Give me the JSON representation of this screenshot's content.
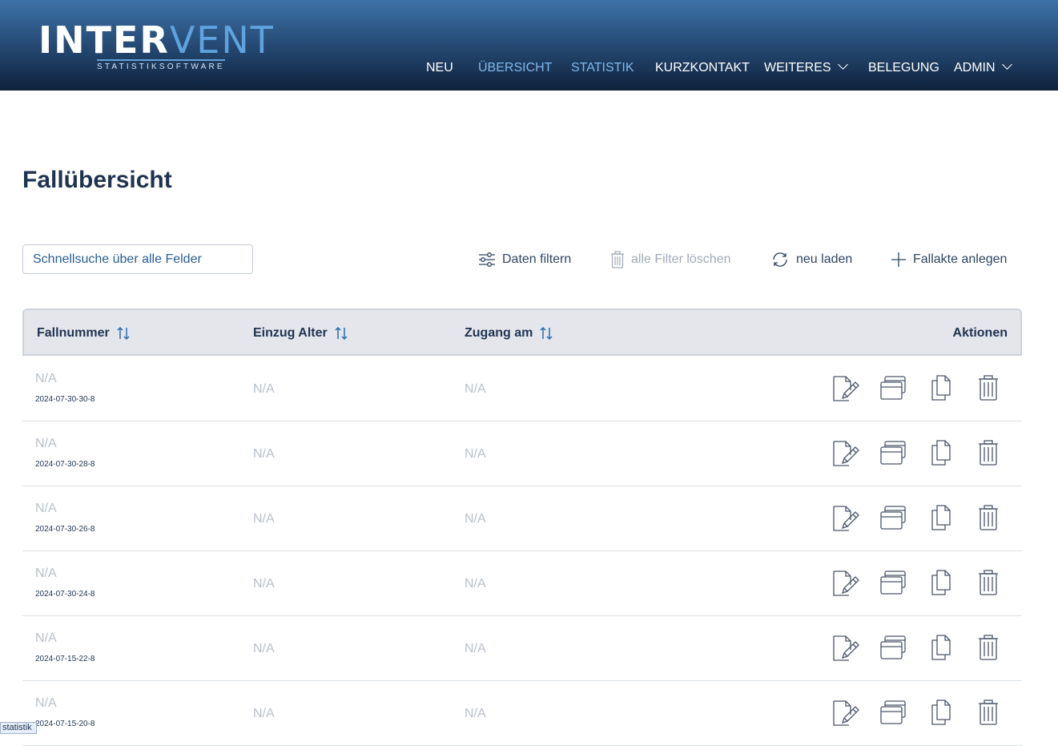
{
  "logo": {
    "word_part1": "INTER",
    "word_part2": "VENT",
    "tagline": "STATISTIKSOFTWARE"
  },
  "nav": {
    "items": [
      {
        "label": "NEU",
        "active": false
      },
      {
        "label": "ÜBERSICHT",
        "active": true
      },
      {
        "label": "STATISTIK",
        "active": true
      },
      {
        "label": "KURZKONTAKT",
        "active": false
      },
      {
        "label": "WEITERES",
        "active": false,
        "dropdown": true
      },
      {
        "label": "BELEGUNG",
        "active": false
      },
      {
        "label": "ADMIN",
        "active": false,
        "dropdown": true
      }
    ]
  },
  "page": {
    "title": "Fallübersicht"
  },
  "search": {
    "placeholder": "Schnellsuche über alle Felder"
  },
  "toolbar": {
    "filter_label": "Daten filtern",
    "clear_label": "alle Filter löschen",
    "reload_label": "neu laden",
    "create_label": "Fallakte anlegen"
  },
  "table": {
    "columns": {
      "case_number": "Fallnummer",
      "entry_age": "Einzug Alter",
      "access_date": "Zugang am",
      "actions": "Aktionen"
    },
    "rows": [
      {
        "case_number": "N/A",
        "id": "2024-07-30-30-8",
        "entry_age": "N/A",
        "access_date": "N/A"
      },
      {
        "case_number": "N/A",
        "id": "2024-07-30-28-8",
        "entry_age": "N/A",
        "access_date": "N/A"
      },
      {
        "case_number": "N/A",
        "id": "2024-07-30-26-8",
        "entry_age": "N/A",
        "access_date": "N/A"
      },
      {
        "case_number": "N/A",
        "id": "2024-07-30-24-8",
        "entry_age": "N/A",
        "access_date": "N/A"
      },
      {
        "case_number": "N/A",
        "id": "2024-07-15-22-8",
        "entry_age": "N/A",
        "access_date": "N/A"
      },
      {
        "case_number": "N/A",
        "id": "2024-07-15-20-8",
        "entry_age": "N/A",
        "access_date": "N/A"
      }
    ]
  },
  "tooltip": {
    "text": "statistik"
  },
  "icons": {
    "filter": "sliders-icon",
    "clear": "trash-icon",
    "reload": "refresh-icon",
    "create": "plus-icon",
    "sort": "sort-arrows-icon",
    "edit": "edit-document-icon",
    "windows": "window-stack-icon",
    "copy": "copy-icon",
    "delete": "trash-icon"
  },
  "colors": {
    "header_top": "#3d72a8",
    "header_bottom": "#0f223c",
    "accent": "#7fb8ec",
    "text": "#1f3350"
  }
}
